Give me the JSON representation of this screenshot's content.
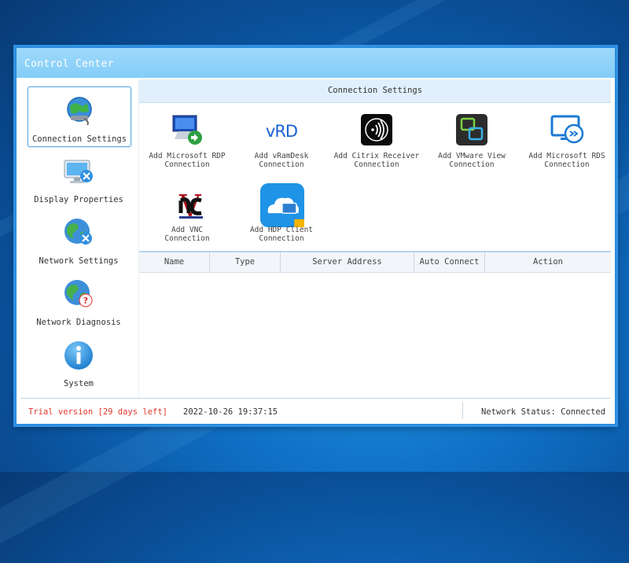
{
  "window": {
    "title": "Control Center"
  },
  "sidebar": {
    "items": [
      {
        "label": "Connection Settings",
        "icon": "connection-settings-icon",
        "active": true
      },
      {
        "label": "Display Properties",
        "icon": "display-properties-icon",
        "active": false
      },
      {
        "label": "Network Settings",
        "icon": "network-settings-icon",
        "active": false
      },
      {
        "label": "Network Diagnosis",
        "icon": "network-diagnosis-icon",
        "active": false
      },
      {
        "label": "System",
        "icon": "info-icon",
        "active": false
      }
    ]
  },
  "main": {
    "header": "Connection Settings",
    "connections": [
      {
        "label": "Add Microsoft RDP\nConnection",
        "icon": "rdp-icon"
      },
      {
        "label": "Add vRamDesk\nConnection",
        "icon": "vrd-icon",
        "icon_text": "vRD"
      },
      {
        "label": "Add Citrix Receiver\nConnection",
        "icon": "citrix-icon"
      },
      {
        "label": "Add VMware View\nConnection",
        "icon": "vmware-icon"
      },
      {
        "label": "Add Microsoft RDS\nConnection",
        "icon": "rds-icon"
      },
      {
        "label": "Add VNC\nConnection",
        "icon": "vnc-icon",
        "icon_text": "V"
      },
      {
        "label": "Add HDP Client\nConnection",
        "icon": "hdp-icon"
      }
    ],
    "table": {
      "columns": [
        "Name",
        "Type",
        "Server Address",
        "Auto Connect",
        "Action"
      ],
      "rows": []
    }
  },
  "statusbar": {
    "trial": "Trial version [29 days left]",
    "datetime": "2022-10-26 19:37:15",
    "network_status": "Network Status: Connected"
  },
  "colors": {
    "accent": "#2e91e4",
    "titlebar": "#8fd2f9",
    "trial_text": "#e2362c",
    "header_bg": "#e1f0fc"
  }
}
